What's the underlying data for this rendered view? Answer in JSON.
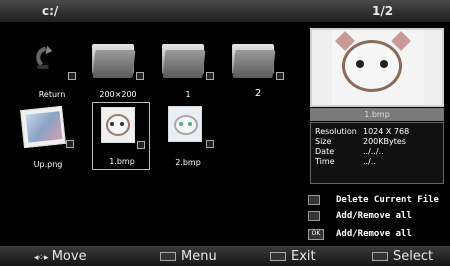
{
  "header": {
    "path": "c:/",
    "page": "1/2"
  },
  "files": [
    {
      "name": "Return",
      "kind": "return"
    },
    {
      "name": "200×200",
      "kind": "folder"
    },
    {
      "name": "1",
      "kind": "folder"
    },
    {
      "name": "2",
      "kind": "folder"
    },
    {
      "name": "Up.png",
      "kind": "image"
    },
    {
      "name": "1.bmp",
      "kind": "image"
    },
    {
      "name": "2.bmp",
      "kind": "image"
    }
  ],
  "preview": {
    "filename": "1.bmp",
    "info": [
      {
        "key": "Resolution",
        "value": "1024 X 768"
      },
      {
        "key": "Size",
        "value": "200KBytes"
      },
      {
        "key": "Date",
        "value": "../../.."
      },
      {
        "key": "Time",
        "value": "../.."
      }
    ]
  },
  "actions": [
    {
      "key": "",
      "label": "Delete Current File"
    },
    {
      "key": "",
      "label": "Add/Remove all"
    },
    {
      "key": "OK",
      "label": "Add/Remove all"
    }
  ],
  "footer": {
    "move": "Move",
    "menu": "Menu",
    "exit": "Exit",
    "select": "Select"
  }
}
